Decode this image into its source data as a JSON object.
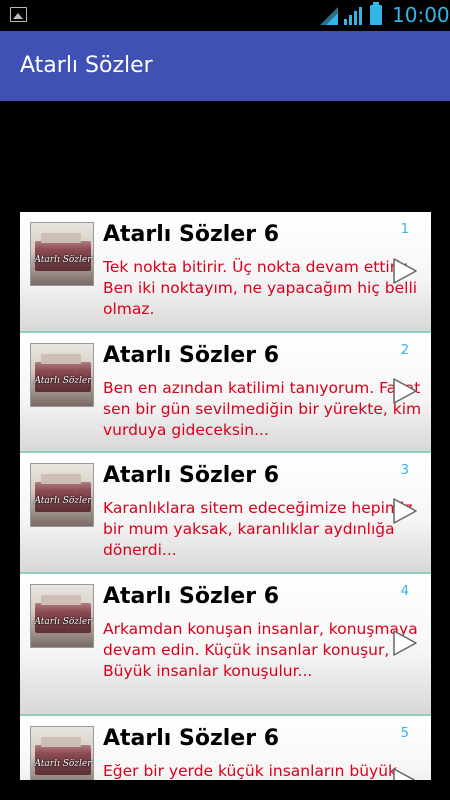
{
  "status_bar": {
    "time": "10:00",
    "icons": [
      "image-notification-icon",
      "wifi-icon",
      "signal-icon",
      "battery-icon"
    ]
  },
  "app": {
    "title": "Atarlı Sözler"
  },
  "colors": {
    "action_bar": "#3f51b5",
    "accent": "#33b5e5",
    "body_text": "#d9001b"
  },
  "items": [
    {
      "index": "1",
      "heading": "Atarlı Sözler 6",
      "thumb_text": "Atarlı Sözler",
      "body": "Tek nokta bitirir. Üç nokta devam ettirir. Ben iki noktayım, ne yapacağım hiç belli olmaz."
    },
    {
      "index": "2",
      "heading": "Atarlı Sözler 6",
      "thumb_text": "Atarlı Sözler",
      "body": "Ben en azından katilimi tanıyorum. Fakat sen bir gün sevilmediğin bir yürekte, kim vurduya gideceksin..."
    },
    {
      "index": "3",
      "heading": "Atarlı Sözler 6",
      "thumb_text": "Atarlı Sözler",
      "body": "Karanlıklara sitem edeceğimize hepimiz bir mum yaksak, karanlıklar aydınlığa dönerdi..."
    },
    {
      "index": "4",
      "heading": "Atarlı Sözler 6",
      "thumb_text": "Atarlı Sözler",
      "body": "Arkamdan konuşan insanlar, konuşmaya devam edin. Küçük insanlar konuşur, Büyük insanlar konuşulur..."
    },
    {
      "index": "5",
      "heading": "Atarlı Sözler 6",
      "thumb_text": "Atarlı Sözler",
      "body": "Eğer bir yerde küçük insanların büyük"
    }
  ]
}
